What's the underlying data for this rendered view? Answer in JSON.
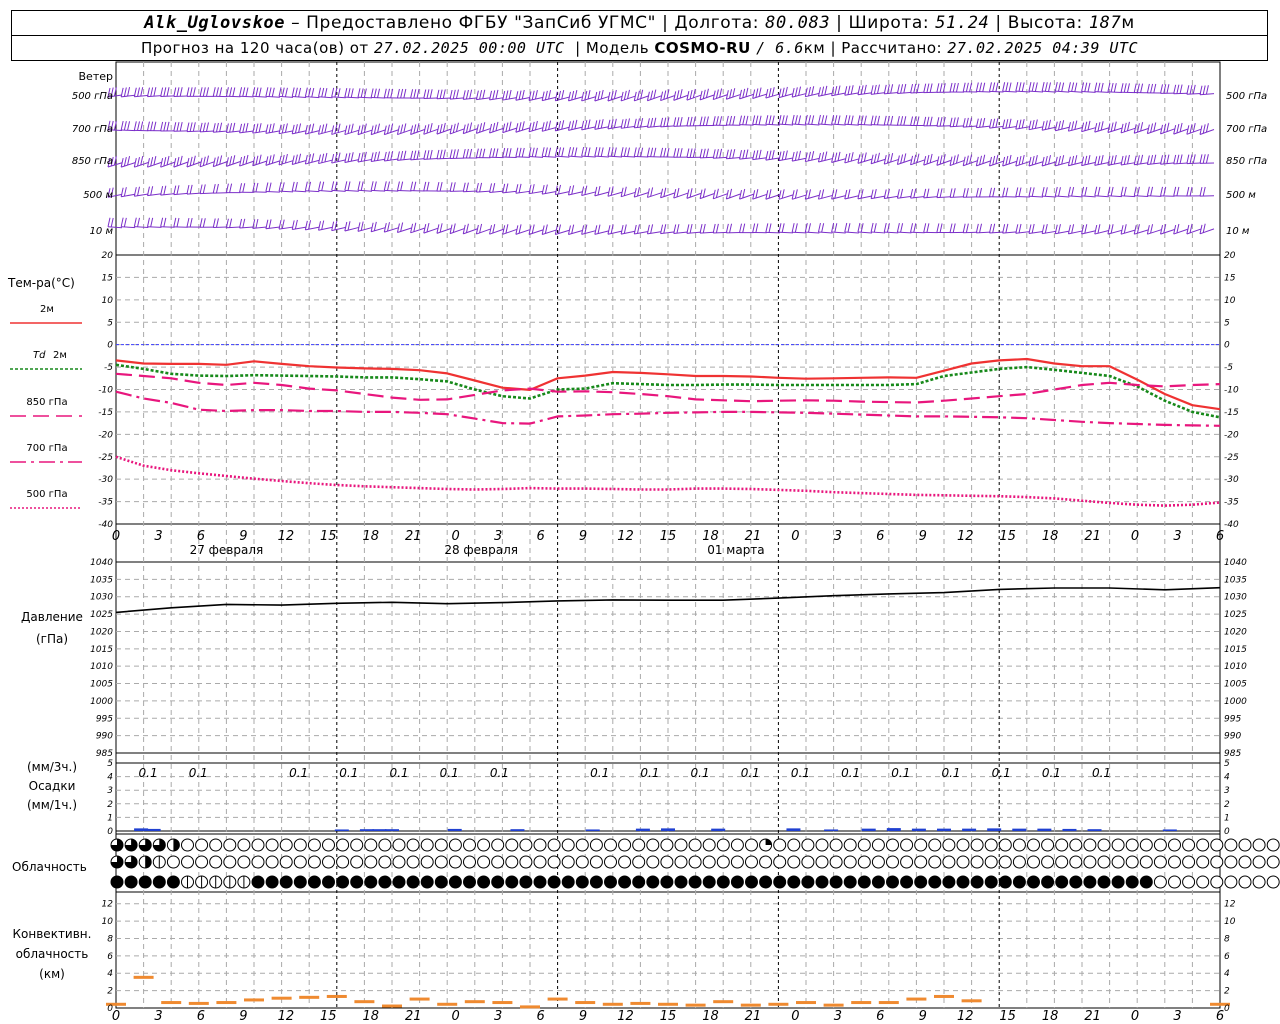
{
  "header": {
    "station": "Alk_Uglovskoe",
    "provided_by": "– Предоставлено ФГБУ \"ЗапСиб УГМС\"",
    "lon_label": "Долгота:",
    "lon_value": "80.083",
    "lat_label": "Широта:",
    "lat_value": "51.24",
    "alt_label": "Высота:",
    "alt_value": "187",
    "alt_unit": "м",
    "forecast_prefix": "Прогноз на 120 часа(ов) от",
    "forecast_start": "27.02.2025 00:00 UTC",
    "model_label": "Модель",
    "model_name": "COSMO-RU",
    "model_res": "/ 6.6",
    "model_res_unit": "км",
    "computed_label": "Рассчитано:",
    "computed_time": "27.02.2025 04:39 UTC"
  },
  "colors": {
    "wind": "#7b2fc9",
    "t2m": "#ef3232",
    "td2m": "#17891a",
    "t850": "#e8167d",
    "t700": "#e8167d",
    "t500": "#e8167d",
    "zero_line": "#3a3aff",
    "pressure": "#000000",
    "precip": "#2040d0",
    "convective": "#ef8a30"
  },
  "hour_ticks": [
    "0",
    "3",
    "6",
    "9",
    "12",
    "15",
    "18",
    "21",
    "0",
    "3",
    "6",
    "9",
    "12",
    "15",
    "18",
    "21",
    "0",
    "3",
    "6",
    "9",
    "12",
    "15",
    "18",
    "21",
    "0",
    "3",
    "6"
  ],
  "dates": [
    "27 февраля",
    "28 февраля",
    "01 марта"
  ],
  "wind_panel": {
    "title": "Ветер",
    "levels": [
      {
        "value": "500",
        "unit": "гПа"
      },
      {
        "value": "700",
        "unit": "гПа"
      },
      {
        "value": "850",
        "unit": "гПа"
      },
      {
        "value": "500",
        "unit": "м"
      },
      {
        "value": "10",
        "unit": "м"
      }
    ],
    "barbs_per_row": 84
  },
  "temp_panel": {
    "title": "Тем-ра(°C)",
    "legend": [
      {
        "label": "2м",
        "style": "solid",
        "color": "#ef3232"
      },
      {
        "label_it": "Td",
        "label": "2м",
        "style": "dotted",
        "color": "#17891a"
      },
      {
        "label": "850 гПа",
        "style": "dashed",
        "color": "#e8167d"
      },
      {
        "label": "700 гПа",
        "style": "dashdot",
        "color": "#e8167d"
      },
      {
        "label": "500 гПа",
        "style": "finedot",
        "color": "#e8167d"
      }
    ],
    "ticks": [
      "20",
      "15",
      "10",
      "5",
      "0",
      "-5",
      "-10",
      "-15",
      "-20",
      "-25",
      "-30",
      "-35",
      "-40"
    ]
  },
  "pressure_panel": {
    "title": "Давление",
    "unit": "(гПа)",
    "ticks": [
      "1040",
      "1035",
      "1030",
      "1025",
      "1020",
      "1015",
      "1010",
      "1005",
      "1000",
      "995",
      "990",
      "985"
    ]
  },
  "precip_panel": {
    "title": "Осадки",
    "unit_top": "(мм/3ч.)",
    "unit_bottom": "(мм/1ч.)",
    "ticks": [
      "5",
      "4",
      "3",
      "2",
      "1",
      "0"
    ],
    "amount_labels": [
      {
        "h": 6,
        "text": "0.1"
      },
      {
        "h": 18,
        "text": "0.1"
      },
      {
        "h": 42,
        "text": "0.1"
      },
      {
        "h": 54,
        "text": "0.1"
      },
      {
        "h": 66,
        "text": "0.1"
      },
      {
        "h": 78,
        "text": "0.1"
      },
      {
        "h": 90,
        "text": "0.1"
      },
      {
        "h": 114,
        "text": "0.1"
      },
      {
        "h": 126,
        "text": "0.1"
      },
      {
        "h": 138,
        "text": "0.1"
      },
      {
        "h": 150,
        "text": "0.1"
      },
      {
        "h": 162,
        "text": "0.1"
      },
      {
        "h": 174,
        "text": "0.1"
      },
      {
        "h": 186,
        "text": "0.1"
      },
      {
        "h": 198,
        "text": "0.1"
      },
      {
        "h": 210,
        "text": "0.1"
      },
      {
        "h": 222,
        "text": "0.1"
      },
      {
        "h": 234,
        "text": "0.1"
      }
    ]
  },
  "cloud_panel": {
    "title": "Облачность",
    "rows": [
      "ttt3hoooooooooooooooooooooooooooooooooooooooooqooooooooooooooooooooooooooooooooooooooo",
      "tth1oooooooooooooooooooooooooooooooooooooooooooooooooooooooooooooooooooooooooooooooooo",
      "ffffflllllffffffffffffffffffffffffffffffffffffffffffffffffffffffffffffffffoooooooooooo"
    ]
  },
  "conv_panel": {
    "title1": "Конвективн.",
    "title2": "облачность",
    "unit": "(км)",
    "ticks": [
      "12",
      "10",
      "8",
      "6",
      "4",
      "2",
      "0"
    ]
  },
  "chart_data": [
    {
      "type": "line",
      "title": "Тем-ра(°C)",
      "x_unit": "часы от 27.02.2025 00:00 UTC",
      "x": [
        0,
        3,
        6,
        9,
        12,
        15,
        18,
        21,
        24,
        27,
        30,
        33,
        36,
        39,
        42,
        45,
        48,
        51,
        54,
        57,
        60,
        63,
        66,
        69,
        72,
        75,
        78,
        81,
        84,
        87,
        90,
        93,
        96,
        99,
        102,
        105,
        108,
        111,
        114,
        117,
        120
      ],
      "ylim": [
        -40,
        20
      ],
      "series": [
        {
          "name": "2м",
          "values": [
            -3.5,
            -4.2,
            -4.3,
            -4.3,
            -4.5,
            -3.7,
            -4.3,
            -4.8,
            -5.1,
            -5.3,
            -5.4,
            -5.7,
            -6.4,
            -8.0,
            -9.6,
            -10.1,
            -7.5,
            -6.9,
            -6.1,
            -6.3,
            -6.6,
            -7.0,
            -7.0,
            -7.1,
            -7.4,
            -7.6,
            -7.5,
            -7.4,
            -7.3,
            -7.4,
            -5.8,
            -4.2,
            -3.5,
            -3.2,
            -4.2,
            -4.8,
            -4.8,
            -7.8,
            -11.0,
            -13.5,
            -14.4
          ]
        },
        {
          "name": "Td 2м",
          "values": [
            -4.5,
            -5.4,
            -6.5,
            -6.9,
            -7.0,
            -6.8,
            -6.9,
            -7.0,
            -7.1,
            -7.3,
            -7.3,
            -7.7,
            -8.2,
            -10.0,
            -11.5,
            -12.0,
            -10.0,
            -9.8,
            -8.6,
            -8.8,
            -9.0,
            -9.0,
            -8.9,
            -8.9,
            -9.0,
            -9.0,
            -9.0,
            -9.0,
            -9.0,
            -8.8,
            -7.0,
            -6.2,
            -5.4,
            -5.0,
            -5.6,
            -6.3,
            -7.0,
            -9.3,
            -12.5,
            -15.0,
            -16.2
          ]
        },
        {
          "name": "850 гПа",
          "values": [
            -6.5,
            -7.0,
            -7.5,
            -8.5,
            -9.0,
            -8.5,
            -9.0,
            -9.8,
            -10.2,
            -11.0,
            -11.8,
            -12.3,
            -12.2,
            -11.2,
            -10.2,
            -9.8,
            -10.5,
            -10.4,
            -10.6,
            -11.0,
            -11.5,
            -12.2,
            -12.4,
            -12.6,
            -12.5,
            -12.4,
            -12.5,
            -12.7,
            -12.8,
            -12.9,
            -12.5,
            -12.0,
            -11.5,
            -11.0,
            -10.0,
            -9.0,
            -8.5,
            -9.0,
            -9.3,
            -9.0,
            -8.8
          ]
        },
        {
          "name": "700 гПа",
          "values": [
            -10.5,
            -12.0,
            -13.0,
            -14.5,
            -14.8,
            -14.6,
            -14.6,
            -14.8,
            -14.8,
            -15.0,
            -15.0,
            -15.2,
            -15.5,
            -16.5,
            -17.5,
            -17.6,
            -16.0,
            -15.8,
            -15.5,
            -15.4,
            -15.2,
            -15.1,
            -15.0,
            -15.0,
            -15.1,
            -15.2,
            -15.4,
            -15.6,
            -15.8,
            -16.0,
            -16.0,
            -16.1,
            -16.2,
            -16.4,
            -16.8,
            -17.2,
            -17.5,
            -17.7,
            -17.9,
            -18.0,
            -18.1
          ]
        },
        {
          "name": "500 гПа",
          "values": [
            -25.0,
            -27.0,
            -28.0,
            -28.7,
            -29.3,
            -29.9,
            -30.4,
            -30.9,
            -31.3,
            -31.6,
            -31.8,
            -32.0,
            -32.2,
            -32.3,
            -32.2,
            -32.0,
            -32.1,
            -32.1,
            -32.2,
            -32.3,
            -32.3,
            -32.1,
            -32.1,
            -32.2,
            -32.4,
            -32.6,
            -32.9,
            -33.1,
            -33.3,
            -33.5,
            -33.6,
            -33.7,
            -33.8,
            -34.0,
            -34.3,
            -34.8,
            -35.3,
            -35.7,
            -35.9,
            -35.7,
            -35.2
          ]
        }
      ]
    },
    {
      "type": "line",
      "title": "Давление",
      "ylabel": "(гПа)",
      "x": [
        0,
        6,
        12,
        18,
        24,
        30,
        36,
        42,
        48,
        54,
        60,
        66,
        72,
        78,
        84,
        90,
        96,
        102,
        108,
        114,
        120
      ],
      "ylim": [
        985,
        1040
      ],
      "series": [
        {
          "name": "Давление",
          "values": [
            1025.5,
            1026.8,
            1027.8,
            1027.6,
            1028.1,
            1028.4,
            1028.0,
            1028.3,
            1028.8,
            1029.1,
            1029.0,
            1029.0,
            1029.6,
            1030.3,
            1030.8,
            1031.2,
            1032.1,
            1032.5,
            1032.5,
            1032.0,
            1032.6
          ]
        }
      ]
    },
    {
      "type": "bar",
      "title": "Осадки",
      "ylabel": "(мм/1ч.)",
      "ylim": [
        0,
        5
      ],
      "x": [
        6,
        9,
        54,
        60,
        63,
        66,
        81,
        96,
        114,
        126,
        132,
        144,
        162,
        171,
        180,
        186,
        192,
        198,
        204,
        210,
        216,
        222,
        228,
        234,
        252
      ],
      "values": [
        0.12,
        0.08,
        0.04,
        0.06,
        0.06,
        0.06,
        0.08,
        0.06,
        0.04,
        0.1,
        0.12,
        0.1,
        0.12,
        0.04,
        0.1,
        0.14,
        0.1,
        0.1,
        0.1,
        0.12,
        0.1,
        0.1,
        0.08,
        0.06,
        0.04
      ]
    },
    {
      "type": "bar",
      "title": "Конвективн. облачность",
      "ylabel": "(км)",
      "ylim": [
        0,
        13
      ],
      "x": [
        0,
        3,
        6,
        9,
        12,
        15,
        18,
        21,
        24,
        27,
        30,
        33,
        36,
        39,
        42,
        45,
        48,
        51,
        54,
        57,
        60,
        63,
        66,
        69,
        72,
        75,
        78,
        81,
        84,
        87,
        90,
        93,
        96,
        99,
        102,
        105,
        108,
        111,
        114,
        117,
        120
      ],
      "values": [
        0.6,
        3.7,
        0.8,
        0.7,
        0.8,
        1.1,
        1.3,
        1.4,
        1.5,
        0.9,
        0.4,
        1.2,
        0.6,
        0.9,
        0.8,
        0.3,
        1.2,
        0.8,
        0.6,
        0.7,
        0.6,
        0.5,
        0.9,
        0.5,
        0.6,
        0.8,
        0.5,
        0.8,
        0.8,
        1.2,
        1.5,
        1.0,
        0.0,
        0.0,
        0.0,
        0.0,
        0.0,
        0.0,
        0.0,
        0.0,
        0.6
      ]
    }
  ]
}
